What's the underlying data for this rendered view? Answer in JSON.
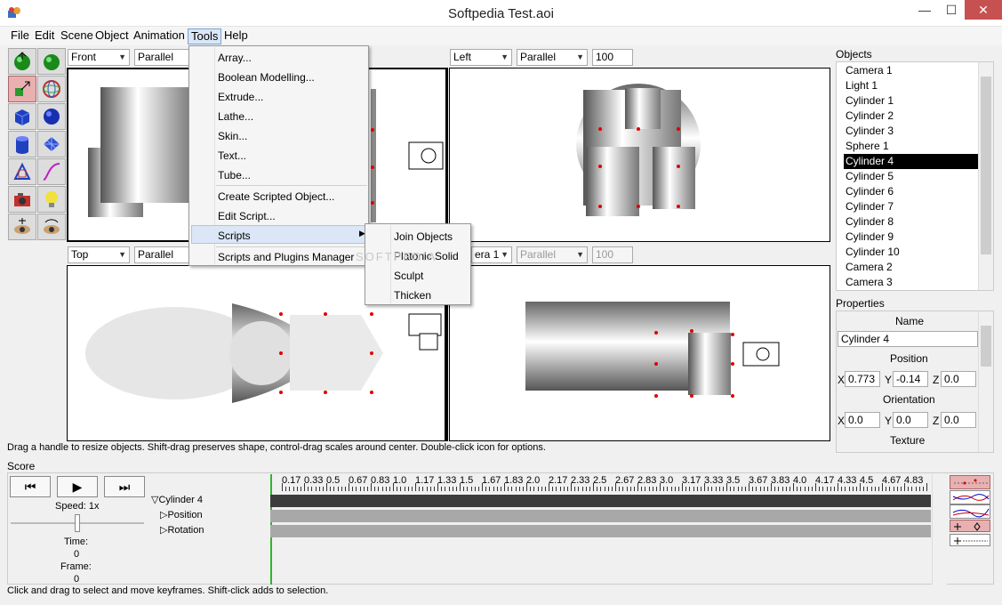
{
  "window": {
    "title": "Softpedia Test.aoi",
    "min_glyph": "—",
    "max_glyph": "☐",
    "close_glyph": "✕"
  },
  "menubar": {
    "items": [
      {
        "label": "File"
      },
      {
        "label": "Edit"
      },
      {
        "label": "Scene"
      },
      {
        "label": "Object"
      },
      {
        "label": "Animation"
      },
      {
        "label": "Tools"
      },
      {
        "label": "Help"
      }
    ]
  },
  "tools_menu": {
    "items": [
      {
        "label": "Array..."
      },
      {
        "label": "Boolean Modelling..."
      },
      {
        "label": "Extrude..."
      },
      {
        "label": "Lathe..."
      },
      {
        "label": "Skin..."
      },
      {
        "label": "Text..."
      },
      {
        "label": "Tube..."
      },
      {
        "label": "Create Scripted Object..."
      },
      {
        "label": "Edit Script..."
      },
      {
        "label": "Scripts"
      },
      {
        "label": "Scripts and Plugins Manager"
      }
    ],
    "submenu": [
      {
        "label": "Join Objects"
      },
      {
        "label": "Platonic Solid"
      },
      {
        "label": "Sculpt"
      },
      {
        "label": "Thicken"
      }
    ]
  },
  "viewports": {
    "top_left": {
      "view": "Front",
      "projection": "Parallel"
    },
    "top_right": {
      "view": "Left",
      "projection": "Parallel",
      "scale": "100"
    },
    "bottom_left": {
      "view": "Top",
      "projection": "Parallel"
    },
    "bottom_right": {
      "view": "era 1",
      "projection": "Parallel",
      "scale": "100"
    }
  },
  "objects_panel": {
    "header": "Objects",
    "items": [
      "Camera 1",
      "Light 1",
      "Cylinder 1",
      "Cylinder 2",
      "Cylinder 3",
      "Sphere 1",
      "Cylinder 4",
      "Cylinder 5",
      "Cylinder 6",
      "Cylinder 7",
      "Cylinder 8",
      "Cylinder 9",
      "Cylinder 10",
      "Camera 2",
      "Camera 3"
    ],
    "selected_index": 6
  },
  "properties": {
    "header": "Properties",
    "name_label": "Name",
    "name_value": "Cylinder 4",
    "position_label": "Position",
    "position": {
      "x": "0.773",
      "y": "-0.14",
      "z": "0.0"
    },
    "orientation_label": "Orientation",
    "orientation": {
      "x": "0.0",
      "y": "0.0",
      "z": "0.0"
    },
    "texture_label": "Texture",
    "axis_x": "X",
    "axis_y": "Y",
    "axis_z": "Z"
  },
  "status_top": "Drag a handle to resize objects.  Shift-drag preserves shape, control-drag scales around center.  Double-click icon for options.",
  "score": {
    "header": "Score",
    "speed_label": "Speed: 1x",
    "time_label": "Time:",
    "time_value": "0",
    "frame_label": "Frame:",
    "frame_value": "0",
    "tracks": {
      "object": "Cylinder 4",
      "children": [
        "Position",
        "Rotation"
      ]
    },
    "timeline_labels": [
      "0.17",
      "0.33",
      "0.5",
      "0.67",
      "0.83",
      "1.0",
      "1.17",
      "1.33",
      "1.5",
      "1.67",
      "1.83",
      "2.0",
      "2.17",
      "2.33",
      "2.5",
      "2.67",
      "2.83",
      "3.0",
      "3.17",
      "3.33",
      "3.5",
      "3.67",
      "3.83",
      "4.0",
      "4.17",
      "4.33",
      "4.5",
      "4.67",
      "4.83"
    ],
    "rewind_glyph": "⏮",
    "play_glyph": "▶",
    "end_glyph": "⏭"
  },
  "status_bottom": "Click and drag to select and move keyframes.  Shift-click adds to selection.",
  "watermark": "SOFTPEDIA"
}
